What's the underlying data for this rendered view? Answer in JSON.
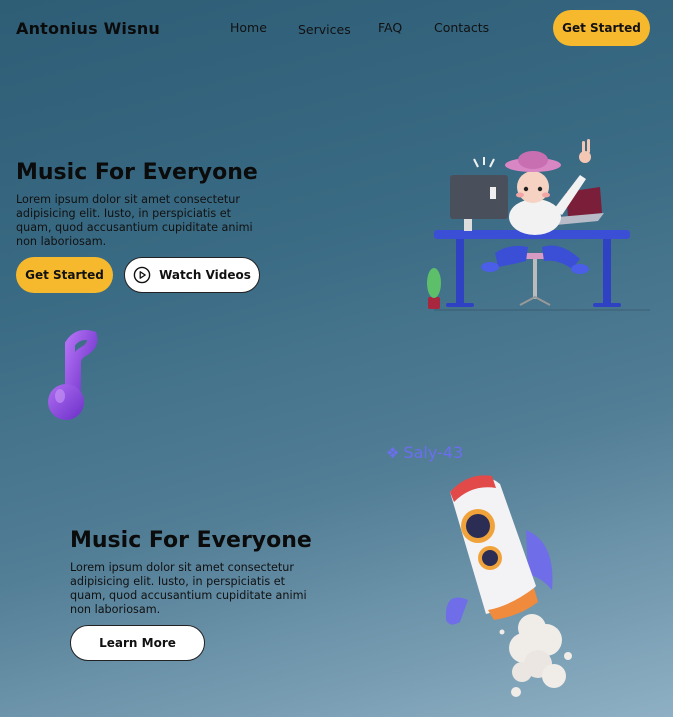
{
  "header": {
    "brand": "Antonius Wisnu",
    "nav": [
      {
        "label": "Home"
      },
      {
        "label": "Services"
      },
      {
        "label": "FAQ"
      },
      {
        "label": "Contacts"
      }
    ],
    "cta_label": "Get Started"
  },
  "hero": {
    "title": "Music For Everyone",
    "body": "Lorem ipsum dolor sit amet consectetur adipisicing elit. Iusto, in perspiciatis et quam, quod accusantium cupiditate animi non laboriosam.",
    "primary_label": "Get Started",
    "secondary_label": "Watch Videos"
  },
  "layer_label": "Saly-43",
  "section2": {
    "title": "Music For Everyone",
    "body": "Lorem ipsum dolor sit amet consectetur adipisicing elit. Iusto, in perspiciatis et quam, quod accusantium cupiditate animi non laboriosam.",
    "button_label": "Learn More"
  },
  "colors": {
    "accent": "#f6b92d",
    "layer_label": "#6c6ef0"
  }
}
